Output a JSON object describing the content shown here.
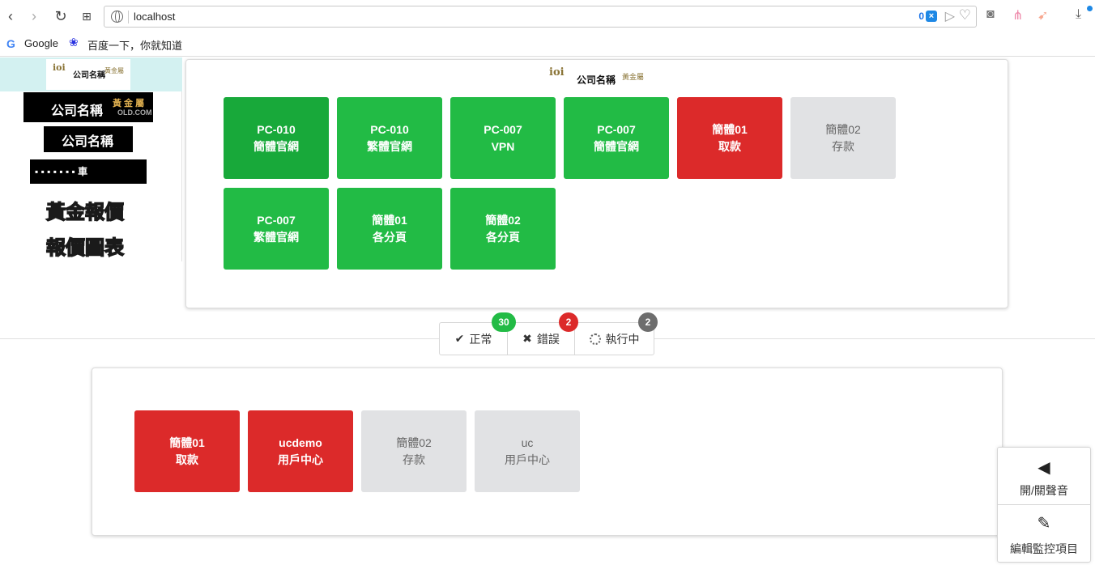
{
  "browser": {
    "url": "localhost",
    "ext_count": "0",
    "bookmarks": [
      "Google",
      "百度一下，你就知道"
    ]
  },
  "sidebar": {
    "logo_mark": "ioi",
    "logo_name": "公司名稱",
    "logo_gold": "黃金屬",
    "banners": [
      {
        "text": "公司名稱",
        "accent": "黃 金 屬",
        "sub": "OLD.COM"
      },
      {
        "text": "公司名稱"
      },
      {
        "text": "▪ ▪ ▪ ▪ ▪ ▪ ▪ 車"
      }
    ],
    "links": [
      "黃金報價",
      "報價圖表"
    ]
  },
  "top_panel": {
    "logo_mark": "ioi",
    "logo_name": "公司名稱",
    "logo_gold": "黃金屬",
    "tiles": [
      {
        "line1": "PC-010",
        "line2": "簡體官網",
        "status": "ok-dark"
      },
      {
        "line1": "PC-010",
        "line2": "繁體官網",
        "status": "ok"
      },
      {
        "line1": "PC-007",
        "line2": "VPN",
        "status": "ok"
      },
      {
        "line1": "PC-007",
        "line2": "簡體官網",
        "status": "ok"
      },
      {
        "line1": "簡體01",
        "line2": "取款",
        "status": "err"
      },
      {
        "line1": "簡體02",
        "line2": "存款",
        "status": "run"
      },
      {
        "line1": "PC-007",
        "line2": "繁體官網",
        "status": "ok"
      },
      {
        "line1": "簡體01",
        "line2": "各分頁",
        "status": "ok"
      },
      {
        "line1": "簡體02",
        "line2": "各分頁",
        "status": "ok"
      }
    ]
  },
  "legend": {
    "ok_label": "正常",
    "ok_count": "30",
    "err_label": "錯誤",
    "err_count": "2",
    "run_label": "執行中",
    "run_count": "2"
  },
  "bottom_panel": {
    "tiles": [
      {
        "line1": "簡體01",
        "line2": "取款",
        "status": "err"
      },
      {
        "line1": "ucdemo",
        "line2": "用戶中心",
        "status": "err"
      },
      {
        "line1": "簡體02",
        "line2": "存款",
        "status": "run"
      },
      {
        "line1": "uc",
        "line2": "用戶中心",
        "status": "run"
      }
    ]
  },
  "controls": {
    "sound_label": "開/關聲音",
    "edit_label": "編輯監控項目"
  },
  "colors": {
    "ok": "#22bb45",
    "error": "#dc2a2a",
    "running": "#e1e2e4",
    "sidebar_bg": "#d3f1f1"
  }
}
